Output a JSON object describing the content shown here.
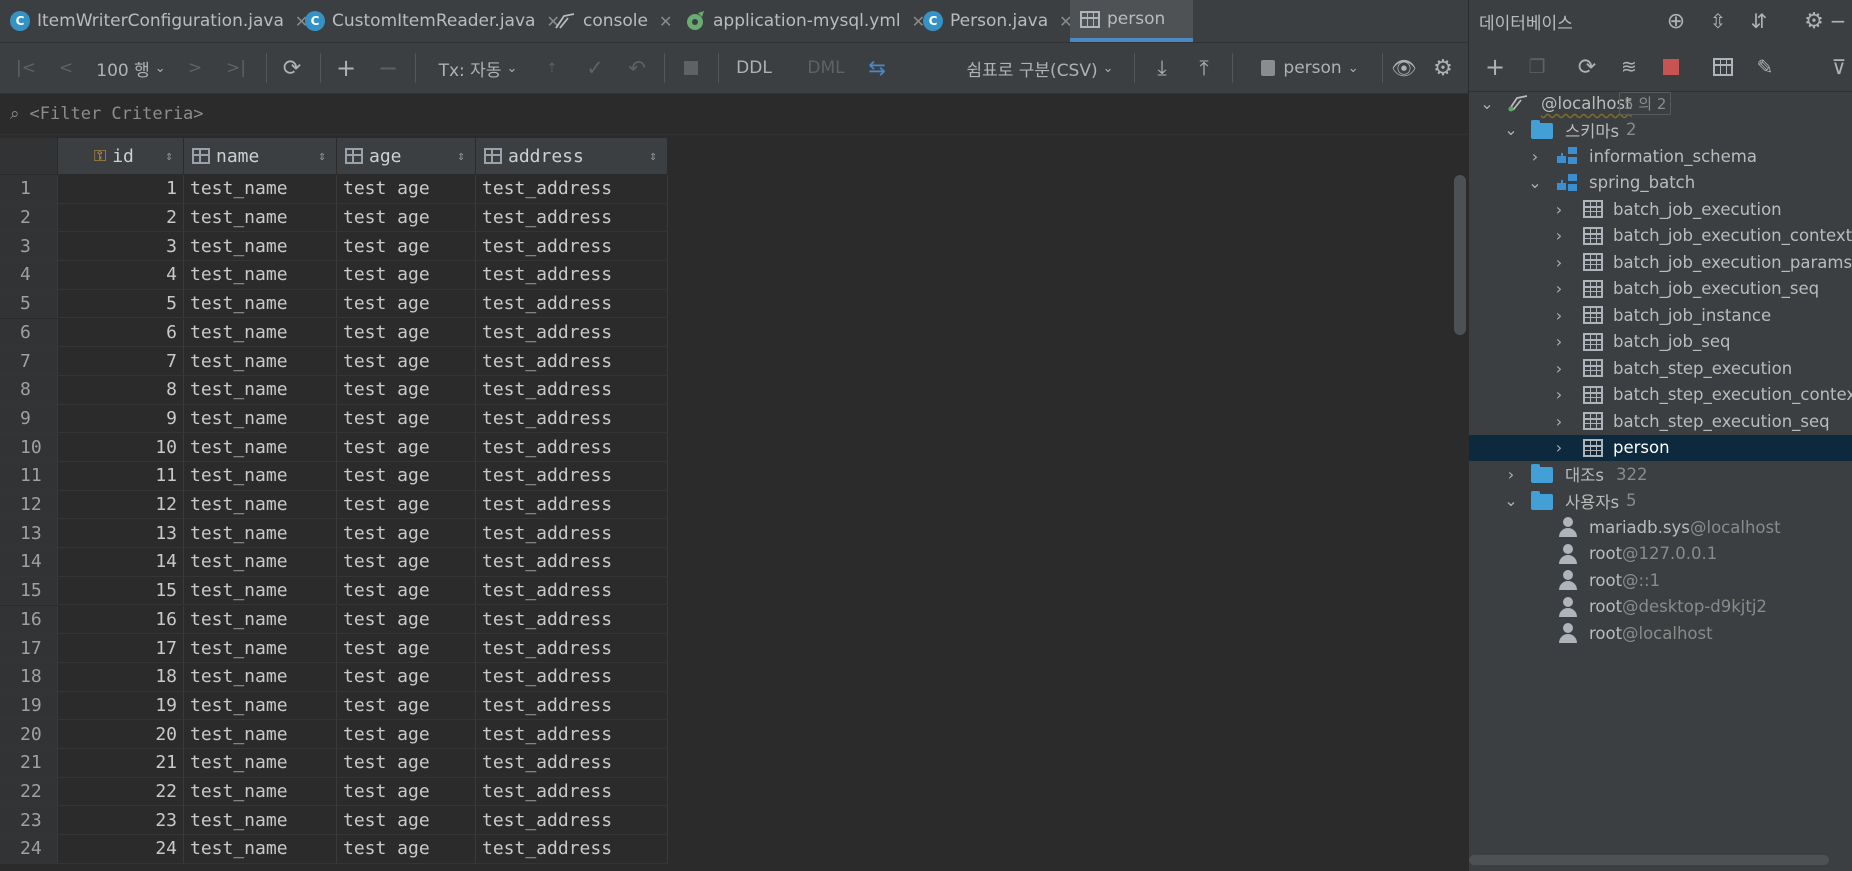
{
  "tabs": [
    {
      "label": "ItemWriterConfiguration.java",
      "icon": "class-icon"
    },
    {
      "label": "CustomItemReader.java",
      "icon": "class-icon"
    },
    {
      "label": "console",
      "icon": "console-icon"
    },
    {
      "label": "application-mysql.yml",
      "icon": "spring-icon"
    },
    {
      "label": "Person.java",
      "icon": "class-icon"
    },
    {
      "label": "person",
      "icon": "table-icon",
      "active": true
    }
  ],
  "toolbar": {
    "rows_label": "100 행",
    "tx_label": "Tx: 자동",
    "ddl_label": "DDL",
    "dml_label": "DML",
    "export_format": "쉼표로 구분(CSV)",
    "table_name": "person"
  },
  "filter": {
    "placeholder": "<Filter Criteria>"
  },
  "grid": {
    "columns": [
      {
        "name": "id",
        "icon": "key-icon"
      },
      {
        "name": "name",
        "icon": "column-icon"
      },
      {
        "name": "age",
        "icon": "column-icon"
      },
      {
        "name": "address",
        "icon": "column-icon"
      }
    ],
    "rows": [
      {
        "n": "1",
        "id": "1",
        "name": "test_name",
        "age": "test age",
        "address": "test_address"
      },
      {
        "n": "2",
        "id": "2",
        "name": "test_name",
        "age": "test age",
        "address": "test_address"
      },
      {
        "n": "3",
        "id": "3",
        "name": "test_name",
        "age": "test age",
        "address": "test_address"
      },
      {
        "n": "4",
        "id": "4",
        "name": "test_name",
        "age": "test age",
        "address": "test_address"
      },
      {
        "n": "5",
        "id": "5",
        "name": "test_name",
        "age": "test age",
        "address": "test_address"
      },
      {
        "n": "6",
        "id": "6",
        "name": "test_name",
        "age": "test age",
        "address": "test_address"
      },
      {
        "n": "7",
        "id": "7",
        "name": "test_name",
        "age": "test age",
        "address": "test_address"
      },
      {
        "n": "8",
        "id": "8",
        "name": "test_name",
        "age": "test age",
        "address": "test_address"
      },
      {
        "n": "9",
        "id": "9",
        "name": "test_name",
        "age": "test age",
        "address": "test_address"
      },
      {
        "n": "10",
        "id": "10",
        "name": "test_name",
        "age": "test age",
        "address": "test_address"
      },
      {
        "n": "11",
        "id": "11",
        "name": "test_name",
        "age": "test age",
        "address": "test_address"
      },
      {
        "n": "12",
        "id": "12",
        "name": "test_name",
        "age": "test age",
        "address": "test_address"
      },
      {
        "n": "13",
        "id": "13",
        "name": "test_name",
        "age": "test age",
        "address": "test_address"
      },
      {
        "n": "14",
        "id": "14",
        "name": "test_name",
        "age": "test age",
        "address": "test_address"
      },
      {
        "n": "15",
        "id": "15",
        "name": "test_name",
        "age": "test age",
        "address": "test_address"
      },
      {
        "n": "16",
        "id": "16",
        "name": "test_name",
        "age": "test age",
        "address": "test_address"
      },
      {
        "n": "17",
        "id": "17",
        "name": "test_name",
        "age": "test age",
        "address": "test_address"
      },
      {
        "n": "18",
        "id": "18",
        "name": "test_name",
        "age": "test age",
        "address": "test_address"
      },
      {
        "n": "19",
        "id": "19",
        "name": "test_name",
        "age": "test age",
        "address": "test_address"
      },
      {
        "n": "20",
        "id": "20",
        "name": "test_name",
        "age": "test age",
        "address": "test_address"
      },
      {
        "n": "21",
        "id": "21",
        "name": "test_name",
        "age": "test age",
        "address": "test_address"
      },
      {
        "n": "22",
        "id": "22",
        "name": "test_name",
        "age": "test age",
        "address": "test_address"
      },
      {
        "n": "23",
        "id": "23",
        "name": "test_name",
        "age": "test age",
        "address": "test_address"
      },
      {
        "n": "24",
        "id": "24",
        "name": "test_name",
        "age": "test age",
        "address": "test_address"
      }
    ]
  },
  "database_panel": {
    "title": "데이터베이스",
    "host": {
      "name": "@localhost",
      "badge": "5 의 2"
    },
    "schemas": {
      "label": "스키마s",
      "count": "2",
      "items": [
        {
          "label": "information_schema",
          "expanded": false
        },
        {
          "label": "spring_batch",
          "expanded": true
        }
      ]
    },
    "tables": [
      "batch_job_execution",
      "batch_job_execution_context",
      "batch_job_execution_params",
      "batch_job_execution_seq",
      "batch_job_instance",
      "batch_job_seq",
      "batch_step_execution",
      "batch_step_execution_context",
      "batch_step_execution_seq",
      "person"
    ],
    "collations": {
      "label": "대조s",
      "count": "322"
    },
    "users": {
      "label": "사용자s",
      "count": "5",
      "items": [
        {
          "user": "mariadb.sys",
          "host": "@localhost"
        },
        {
          "user": "root",
          "host": "@127.0.0.1"
        },
        {
          "user": "root",
          "host": "@::1"
        },
        {
          "user": "root",
          "host": "@desktop-d9kjtj2"
        },
        {
          "user": "root",
          "host": "@localhost"
        }
      ]
    }
  },
  "colors": {
    "accent": "#4a88c7",
    "selection": "#0d293e",
    "folder": "#43a0d6",
    "stop": "#c75450"
  }
}
